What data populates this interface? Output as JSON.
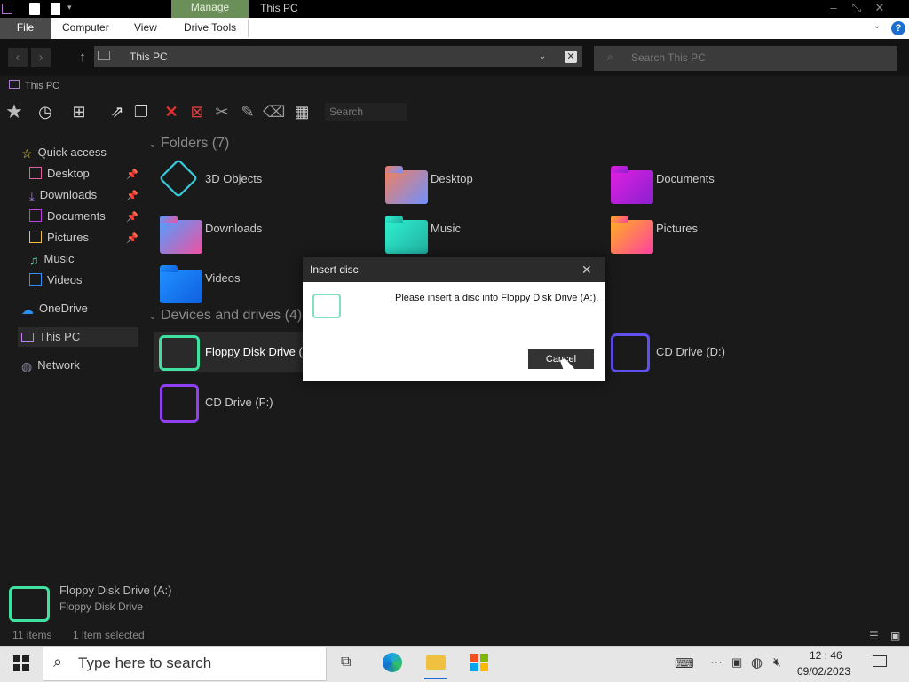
{
  "window": {
    "title": "This PC",
    "context_tab": "Manage",
    "minimize": "–",
    "maximize": "⤡",
    "close": "✕"
  },
  "ribbon": {
    "tabs": [
      "File",
      "Computer",
      "View",
      "Drive Tools"
    ],
    "help": "?"
  },
  "address": {
    "path": "This PC",
    "search_placeholder": "Search This PC"
  },
  "tab": {
    "label": "This PC"
  },
  "toolbar": {
    "search_placeholder": "Search"
  },
  "sidebar": {
    "quick_access": "Quick access",
    "items": [
      "Desktop",
      "Downloads",
      "Documents",
      "Pictures",
      "Music",
      "Videos"
    ],
    "onedrive": "OneDrive",
    "thispc": "This PC",
    "network": "Network"
  },
  "folders": {
    "title": "Folders (7)",
    "items": [
      "3D Objects",
      "Desktop",
      "Documents",
      "Downloads",
      "Music",
      "Pictures",
      "Videos"
    ]
  },
  "devices": {
    "title": "Devices and drives (4)",
    "items": [
      "Floppy Disk Drive (A:)",
      "CD Drive (D:)",
      "CD Drive (F:)"
    ]
  },
  "dialog": {
    "title": "Insert disc",
    "message": "Please insert a disc into Floppy Disk Drive (A:).",
    "cancel": "Cancel",
    "close": "✕"
  },
  "details": {
    "name": "Floppy Disk Drive (A:)",
    "type": "Floppy Disk Drive"
  },
  "status": {
    "items": "11 items",
    "selected": "1 item selected"
  },
  "taskbar": {
    "search": "Type here to search",
    "time": "12 : 46",
    "date": "09/02/2023"
  }
}
